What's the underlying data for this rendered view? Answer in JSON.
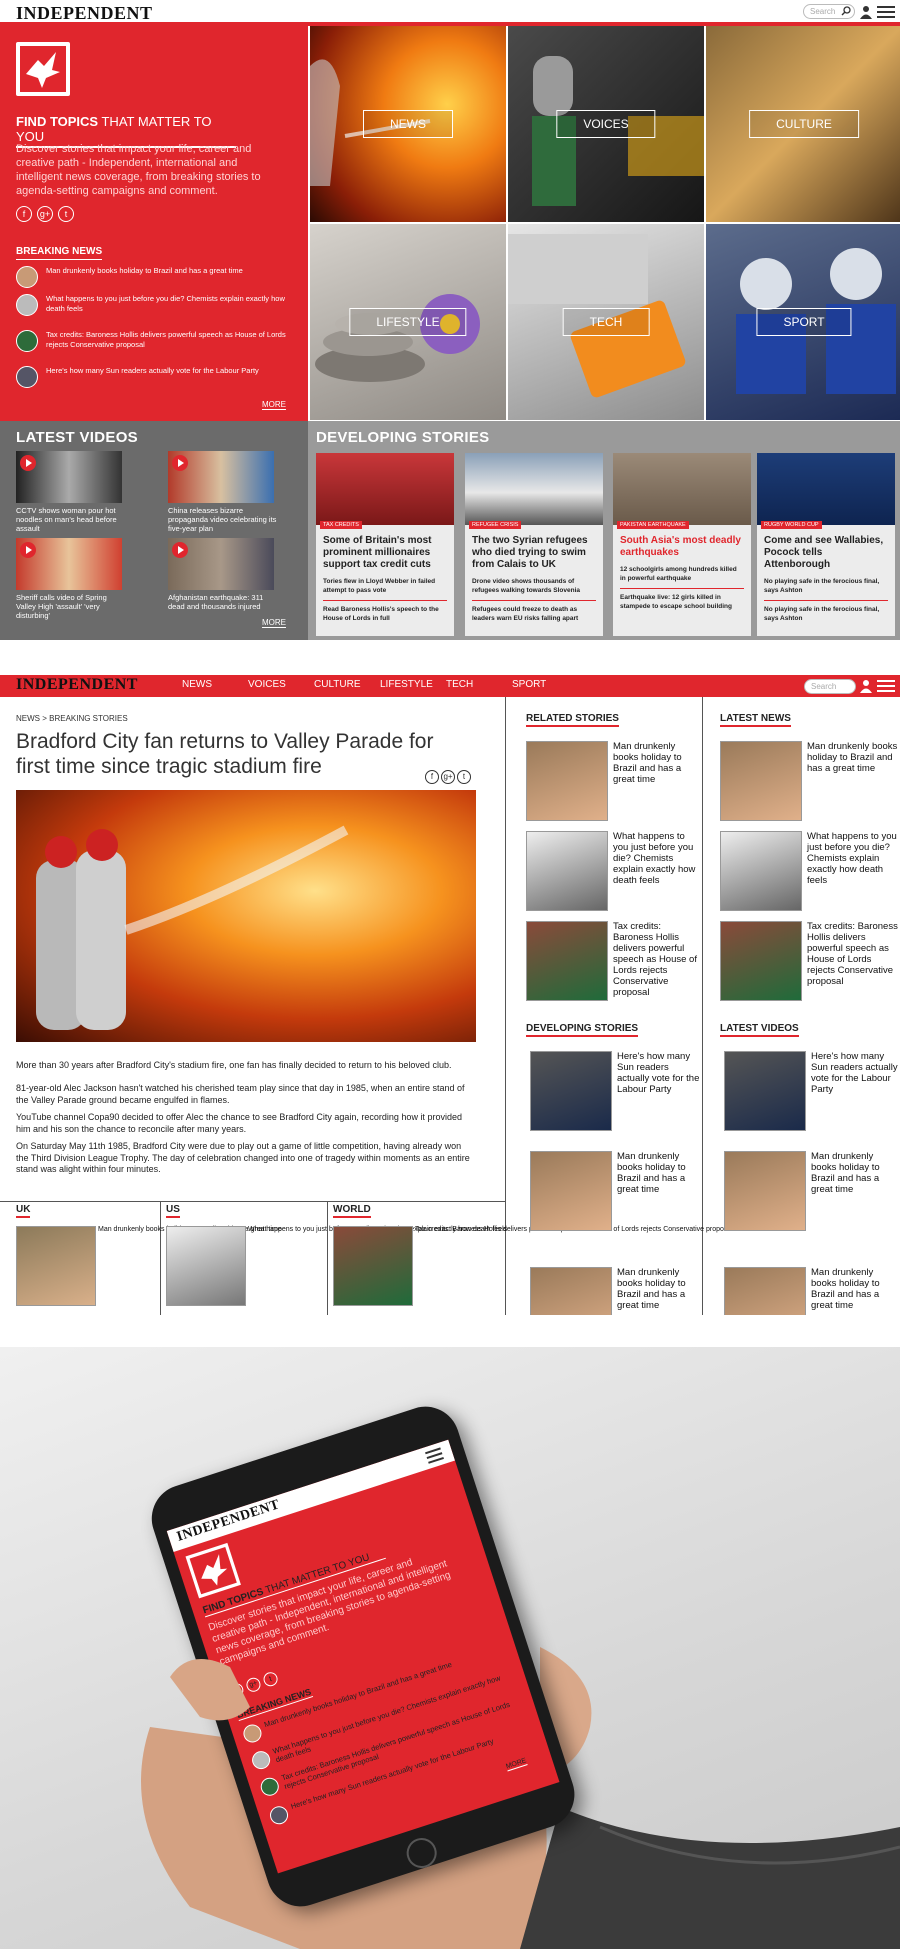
{
  "desktop_home": {
    "logo": "INDEPENDENT",
    "search_placeholder": "Search",
    "hero": {
      "tagline_strong": "FIND TOPICS",
      "tagline_rest": " THAT MATTER TO YOU",
      "description": "Discover stories that impact your life, career and creative path - Independent, international and intelligent news coverage, from breaking stories to agenda-setting campaigns and comment."
    },
    "social_icons": [
      "facebook-icon",
      "google-plus-icon",
      "twitter-icon"
    ],
    "breaking_news": {
      "heading": "BREAKING NEWS",
      "items": [
        "Man drunkenly books holiday to Brazil and has a great time",
        "What happens to you just before you die? Chemists explain exactly how death feels",
        "Tax credits: Baroness Hollis delivers powerful speech as House of Lords rejects Conservative proposal",
        "Here's how many Sun readers actually vote for the Labour Party"
      ],
      "more": "MORE"
    },
    "tiles": [
      "NEWS",
      "VOICES",
      "CULTURE",
      "LIFESTYLE",
      "TECH",
      "SPORT"
    ],
    "latest_videos": {
      "heading": "LATEST VIDEOS",
      "items": [
        "CCTV shows woman pour hot noodles on man's head before assault",
        "China releases bizarre propaganda video celebrating its five-year plan",
        "Sheriff calls video of Spring Valley High 'assault' 'very disturbing'",
        "Afghanistan earthquake: 311 dead and thousands injured"
      ],
      "more": "MORE"
    },
    "developing_stories": {
      "heading": "DEVELOPING STORIES",
      "cards": [
        {
          "tag": "TAX CREDITS",
          "title": "Some of Britain's most prominent millionaires support tax credit cuts",
          "sub1": "Tories flew in Lloyd Webber in failed attempt to pass vote",
          "sub2": "Read Baroness Hollis's speech to the House of Lords in full"
        },
        {
          "tag": "REFUGEE CRISIS",
          "title": "The two Syrian refugees who died trying to swim from Calais to UK",
          "sub1": "Drone video shows thousands of refugees walking towards Slovenia",
          "sub2": "Refugees could freeze to death as leaders warn EU risks falling apart"
        },
        {
          "tag": "PAKISTAN EARTHQUAKE",
          "title": "South Asia's most deadly earthquakes",
          "sub1": "12 schoolgirls among hundreds killed in powerful earthquake",
          "sub2": "Earthquake live: 12 girls killed in stampede to escape school building"
        },
        {
          "tag": "RUGBY WORLD CUP",
          "title": "Come and see Wallabies, Pocock tells Attenborough",
          "sub1": "No playing safe in the ferocious final, says Ashton",
          "sub2": "No playing safe in the ferocious final, says Ashton"
        }
      ]
    }
  },
  "article_page": {
    "logo": "INDEPENDENT",
    "nav": [
      "NEWS",
      "VOICES",
      "CULTURE",
      "LIFESTYLE",
      "TECH",
      "SPORT"
    ],
    "search_placeholder": "Search",
    "breadcrumb": "NEWS > BREAKING STORIES",
    "headline": "Bradford City fan returns to Valley Parade for first time since tragic stadium fire",
    "paragraphs": [
      "More than 30 years after Bradford City's stadium fire, one fan has finally decided to return to his beloved club.",
      "81-year-old Alec Jackson hasn't watched his cherished team play since that day in 1985, when an entire stand of the Valley Parade ground became engulfed in flames.",
      "YouTube channel Copa90 decided to offer Alec the chance to see Bradford City again, recording how it provided him and his son the chance to reconcile after many years.",
      "On Saturday May 11th 1985, Bradford City were due to play out a game of little competition, having already won the Third Division League Trophy. The day of celebration changed into one of tragedy within moments as an entire stand was alight within four minutes."
    ],
    "bottom_sections": [
      {
        "heading": "UK",
        "text": "Man drunkenly books holiday to Brazil and has a great time"
      },
      {
        "heading": "US",
        "text": "What happens to you just before you die? Chemists explain exactly how death feels"
      },
      {
        "heading": "WORLD",
        "text": "Tax credits: Baroness Hollis delivers powerful speech as House of Lords rejects Conservative proposal"
      }
    ],
    "related_stories": {
      "heading": "RELATED STORIES",
      "items": [
        "Man drunkenly books holiday to Brazil and has a great time",
        "What happens to you just before you die? Chemists explain exactly how death feels",
        "Tax credits: Baroness Hollis delivers powerful speech as House of Lords rejects Conservative proposal"
      ]
    },
    "latest_news": {
      "heading": "LATEST NEWS",
      "items": [
        "Man drunkenly books holiday to Brazil and has a great time",
        "What happens to you just before you die? Chemists explain exactly how death feels",
        "Tax credits: Baroness Hollis delivers powerful speech as House of Lords rejects Conservative proposal"
      ]
    },
    "developing_stories": {
      "heading": "DEVELOPING STORIES",
      "items": [
        "Here's how many Sun readers actually vote for the Labour Party",
        "Man drunkenly books holiday to Brazil and has a great time",
        "Man drunkenly books holiday to Brazil and has a great time"
      ]
    },
    "latest_videos": {
      "heading": "LATEST VIDEOS",
      "items": [
        "Here's how many Sun readers actually vote for the Labour Party",
        "Man drunkenly books holiday to Brazil and has a great time",
        "Man drunkenly books holiday to Brazil and has a great time"
      ]
    }
  },
  "mobile_mockup": {
    "logo": "INDEPENDENT",
    "tagline_strong": "FIND TOPICS",
    "tagline_rest": " THAT MATTER TO YOU",
    "description": "Discover stories that impact your life, career and creative path - Independent, international and intelligent news coverage, from breaking stories to agenda-setting campaigns and comment.",
    "breaking_heading": "BREAKING NEWS",
    "items": [
      "Man drunkenly books holiday to Brazil and has a great time",
      "What happens to you just before you die? Chemists explain exactly how death feels",
      "Tax credits: Baroness Hollis delivers powerful speech as House of Lords rejects Conservative proposal",
      "Here's how many Sun readers actually vote for the Labour Party"
    ],
    "more": "MORE"
  },
  "colors": {
    "brand_red": "#e0262d",
    "dark_grey": "#6b6b6b",
    "mid_grey": "#9a9a9a"
  }
}
